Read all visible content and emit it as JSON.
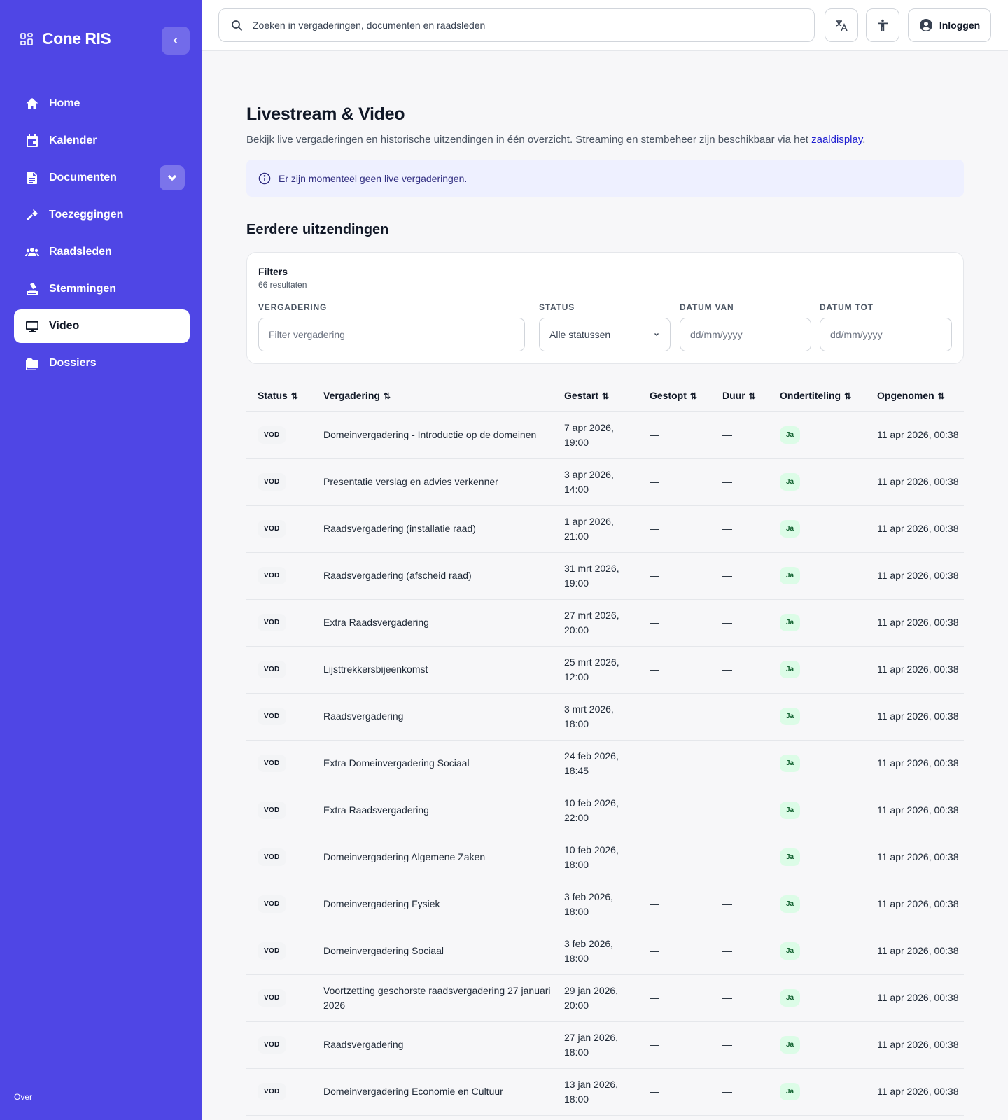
{
  "app": {
    "name": "Cone RIS"
  },
  "sidebar": {
    "items": [
      {
        "label": "Home",
        "icon": "home-icon"
      },
      {
        "label": "Kalender",
        "icon": "calendar-icon"
      },
      {
        "label": "Documenten",
        "icon": "document-icon"
      },
      {
        "label": "Toezeggingen",
        "icon": "handshake-icon"
      },
      {
        "label": "Raadsleden",
        "icon": "people-icon"
      },
      {
        "label": "Stemmingen",
        "icon": "ballot-icon"
      },
      {
        "label": "Video",
        "icon": "monitor-icon"
      },
      {
        "label": "Dossiers",
        "icon": "folder-icon"
      }
    ],
    "footer": "Over"
  },
  "topbar": {
    "search_placeholder": "Zoeken in vergaderingen, documenten en raadsleden",
    "login_label": "Inloggen"
  },
  "page": {
    "title": "Livestream & Video",
    "description": "Bekijk live vergaderingen en historische uitzendingen in één overzicht. Streaming en stembeheer zijn beschikbaar via het ",
    "description_link": "zaaldisplay",
    "description_end": ".",
    "info": "Er zijn momenteel geen live vergaderingen.",
    "section_title": "Eerdere uitzendingen"
  },
  "filters": {
    "title": "Filters",
    "count": "66 resultaten",
    "meeting_label": "VERGADERING",
    "meeting_placeholder": "Filter vergadering",
    "status_label": "STATUS",
    "status_value": "Alle statussen",
    "date_from_label": "DATUM VAN",
    "date_from_placeholder": "dd/mm/yyyy",
    "date_to_label": "DATUM TOT",
    "date_to_placeholder": "dd/mm/yyyy"
  },
  "table": {
    "columns": [
      "Status",
      "Vergadering",
      "Gestart",
      "Gestopt",
      "Duur",
      "Ondertiteling",
      "Opgenomen"
    ],
    "rows": [
      {
        "status": "VOD",
        "meeting": "Domeinvergadering - Introductie op de domeinen",
        "started": "7 apr 2026, 19:00",
        "stopped": "—",
        "duration": "—",
        "subtitles": "Ja",
        "recorded": "11 apr 2026, 00:38"
      },
      {
        "status": "VOD",
        "meeting": "Presentatie verslag en advies verkenner",
        "started": "3 apr 2026, 14:00",
        "stopped": "—",
        "duration": "—",
        "subtitles": "Ja",
        "recorded": "11 apr 2026, 00:38"
      },
      {
        "status": "VOD",
        "meeting": "Raadsvergadering (installatie raad)",
        "started": "1 apr 2026, 21:00",
        "stopped": "—",
        "duration": "—",
        "subtitles": "Ja",
        "recorded": "11 apr 2026, 00:38"
      },
      {
        "status": "VOD",
        "meeting": "Raadsvergadering (afscheid raad)",
        "started": "31 mrt 2026, 19:00",
        "stopped": "—",
        "duration": "—",
        "subtitles": "Ja",
        "recorded": "11 apr 2026, 00:38"
      },
      {
        "status": "VOD",
        "meeting": "Extra Raadsvergadering",
        "started": "27 mrt 2026, 20:00",
        "stopped": "—",
        "duration": "—",
        "subtitles": "Ja",
        "recorded": "11 apr 2026, 00:38"
      },
      {
        "status": "VOD",
        "meeting": "Lijsttrekkersbijeenkomst",
        "started": "25 mrt 2026, 12:00",
        "stopped": "—",
        "duration": "—",
        "subtitles": "Ja",
        "recorded": "11 apr 2026, 00:38"
      },
      {
        "status": "VOD",
        "meeting": "Raadsvergadering",
        "started": "3 mrt 2026, 18:00",
        "stopped": "—",
        "duration": "—",
        "subtitles": "Ja",
        "recorded": "11 apr 2026, 00:38"
      },
      {
        "status": "VOD",
        "meeting": "Extra Domeinvergadering Sociaal",
        "started": "24 feb 2026, 18:45",
        "stopped": "—",
        "duration": "—",
        "subtitles": "Ja",
        "recorded": "11 apr 2026, 00:38"
      },
      {
        "status": "VOD",
        "meeting": "Extra Raadsvergadering",
        "started": "10 feb 2026, 22:00",
        "stopped": "—",
        "duration": "—",
        "subtitles": "Ja",
        "recorded": "11 apr 2026, 00:38"
      },
      {
        "status": "VOD",
        "meeting": "Domeinvergadering Algemene Zaken",
        "started": "10 feb 2026, 18:00",
        "stopped": "—",
        "duration": "—",
        "subtitles": "Ja",
        "recorded": "11 apr 2026, 00:38"
      },
      {
        "status": "VOD",
        "meeting": "Domeinvergadering Fysiek",
        "started": "3 feb 2026, 18:00",
        "stopped": "—",
        "duration": "—",
        "subtitles": "Ja",
        "recorded": "11 apr 2026, 00:38"
      },
      {
        "status": "VOD",
        "meeting": "Domeinvergadering Sociaal",
        "started": "3 feb 2026, 18:00",
        "stopped": "—",
        "duration": "—",
        "subtitles": "Ja",
        "recorded": "11 apr 2026, 00:38"
      },
      {
        "status": "VOD",
        "meeting": "Voortzetting geschorste raadsvergadering 27 januari 2026",
        "started": "29 jan 2026, 20:00",
        "stopped": "—",
        "duration": "—",
        "subtitles": "Ja",
        "recorded": "11 apr 2026, 00:38"
      },
      {
        "status": "VOD",
        "meeting": "Raadsvergadering",
        "started": "27 jan 2026, 18:00",
        "stopped": "—",
        "duration": "—",
        "subtitles": "Ja",
        "recorded": "11 apr 2026, 00:38"
      },
      {
        "status": "VOD",
        "meeting": "Domeinvergadering Economie en Cultuur",
        "started": "13 jan 2026, 18:00",
        "stopped": "—",
        "duration": "—",
        "subtitles": "Ja",
        "recorded": "11 apr 2026, 00:38"
      }
    ]
  }
}
